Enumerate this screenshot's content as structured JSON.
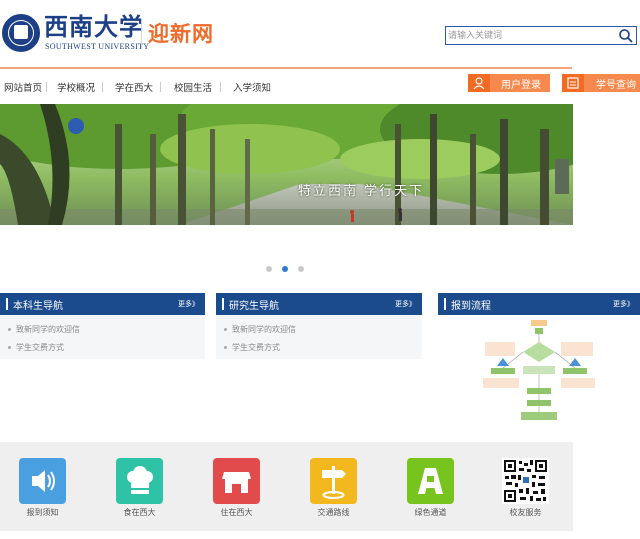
{
  "header": {
    "logo_name": "西南大学",
    "logo_en": "SOUTHWEST UNIVERSITY",
    "site_name": "迎新网",
    "search_placeholder": "请输入关键词"
  },
  "nav": {
    "items": [
      "网站首页",
      "学校概况",
      "学在西大",
      "校园生活",
      "入学须知"
    ],
    "login_label": "用户登录",
    "student_id_label": "学号查询"
  },
  "banner": {
    "slogan": "特立西南  学行天下",
    "slide_count": 3,
    "active_slide": 2
  },
  "sections": [
    {
      "title": "本科生导航",
      "more": "更多》",
      "items": [
        "致新同学的欢迎信",
        "学生交费方式"
      ]
    },
    {
      "title": "研究生导航",
      "more": "更多》",
      "items": [
        "致新同学的欢迎信",
        "学生交费方式"
      ]
    },
    {
      "title": "报到流程",
      "more": "更多》",
      "items": []
    }
  ],
  "services": [
    {
      "label": "报到须知",
      "color": "#4a9fe0",
      "icon": "speaker-icon"
    },
    {
      "label": "食在西大",
      "color": "#2ec2a7",
      "icon": "chef-hat-icon"
    },
    {
      "label": "住在西大",
      "color": "#e24b4b",
      "icon": "shop-icon"
    },
    {
      "label": "交通路线",
      "color": "#f4b81f",
      "icon": "signpost-icon"
    },
    {
      "label": "绿色通道",
      "color": "#76c41d",
      "icon": "letter-a-icon"
    },
    {
      "label": "校友服务",
      "color": "#ffffff",
      "icon": "qr-code-icon"
    }
  ],
  "colors": {
    "brand_blue": "#1b4b8c",
    "accent_orange": "#f36a22"
  }
}
